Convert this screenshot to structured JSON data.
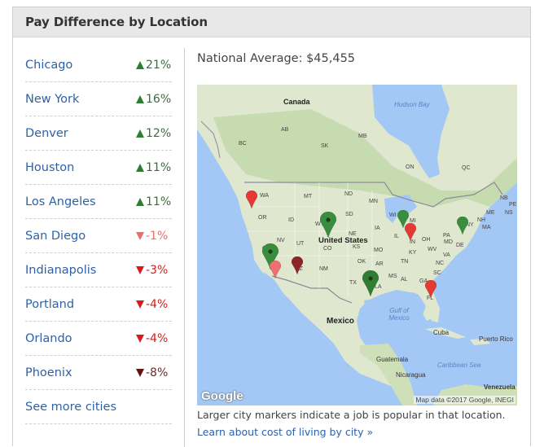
{
  "panel": {
    "title": "Pay Difference by Location"
  },
  "cities": [
    {
      "name": "Chicago",
      "change": "21%",
      "direction": "up",
      "color": "#2e7d32"
    },
    {
      "name": "New York",
      "change": "16%",
      "direction": "up",
      "color": "#2e7d32"
    },
    {
      "name": "Denver",
      "change": "12%",
      "direction": "up",
      "color": "#2e7d32"
    },
    {
      "name": "Houston",
      "change": "11%",
      "direction": "up",
      "color": "#2e7d32"
    },
    {
      "name": "Los Angeles",
      "change": "11%",
      "direction": "up",
      "color": "#2e7d32"
    },
    {
      "name": "San Diego",
      "change": "-1%",
      "direction": "down",
      "color": "#ef6b6b"
    },
    {
      "name": "Indianapolis",
      "change": "-3%",
      "direction": "down",
      "color": "#d81b1b"
    },
    {
      "name": "Portland",
      "change": "-4%",
      "direction": "down",
      "color": "#d81b1b"
    },
    {
      "name": "Orlando",
      "change": "-4%",
      "direction": "down",
      "color": "#d81b1b"
    },
    {
      "name": "Phoenix",
      "change": "-8%",
      "direction": "down",
      "color": "#6b0f0f"
    }
  ],
  "see_more_label": "See more cities",
  "national_average": "National Average: $45,455",
  "map": {
    "labels": {
      "canada": "Canada",
      "hudson_bay": "Hudson Bay",
      "united_states": "United States",
      "mexico": "Mexico",
      "gulf": "Gulf of Mexico",
      "cuba": "Cuba",
      "puerto_rico": "Puerto Rico",
      "caribbean": "Caribbean Sea",
      "guatemala": "Guatemala",
      "nicaragua": "Nicaragua",
      "venezuela": "Venezuela"
    },
    "regions": [
      "AB",
      "BC",
      "SK",
      "MB",
      "ON",
      "QC",
      "NB",
      "PE",
      "NS",
      "WA",
      "MT",
      "ND",
      "MN",
      "OR",
      "ID",
      "WY",
      "SD",
      "WI",
      "MI",
      "NY",
      "ME",
      "NH",
      "MA",
      "NE",
      "IA",
      "IL",
      "IN",
      "OH",
      "PA",
      "NV",
      "UT",
      "CO",
      "KS",
      "MO",
      "KY",
      "WV",
      "MD",
      "DE",
      "VA",
      "CA",
      "AZ",
      "NM",
      "OK",
      "AR",
      "TN",
      "NC",
      "SC",
      "TX",
      "MS",
      "AL",
      "GA",
      "LA",
      "FL"
    ],
    "google_logo": "Google",
    "attribution": "Map data ©2017 Google, INEGI",
    "markers": [
      {
        "city": "Portland",
        "color": "#e53935",
        "size": "small"
      },
      {
        "city": "Denver",
        "color": "#388e3c",
        "size": "large"
      },
      {
        "city": "Los Angeles",
        "color": "#388e3c",
        "size": "large"
      },
      {
        "city": "San Diego",
        "color": "#ef7070",
        "size": "small"
      },
      {
        "city": "Phoenix",
        "color": "#8e2525",
        "size": "small"
      },
      {
        "city": "Chicago",
        "color": "#388e3c",
        "size": "small"
      },
      {
        "city": "Indianapolis",
        "color": "#e53935",
        "size": "small"
      },
      {
        "city": "New York",
        "color": "#388e3c",
        "size": "small"
      },
      {
        "city": "Houston",
        "color": "#2e7d32",
        "size": "large"
      },
      {
        "city": "Orlando",
        "color": "#e53935",
        "size": "small"
      }
    ]
  },
  "caption": "Larger city markers indicate a job is popular in that location.",
  "learn_link": "Learn about cost of living by city »"
}
